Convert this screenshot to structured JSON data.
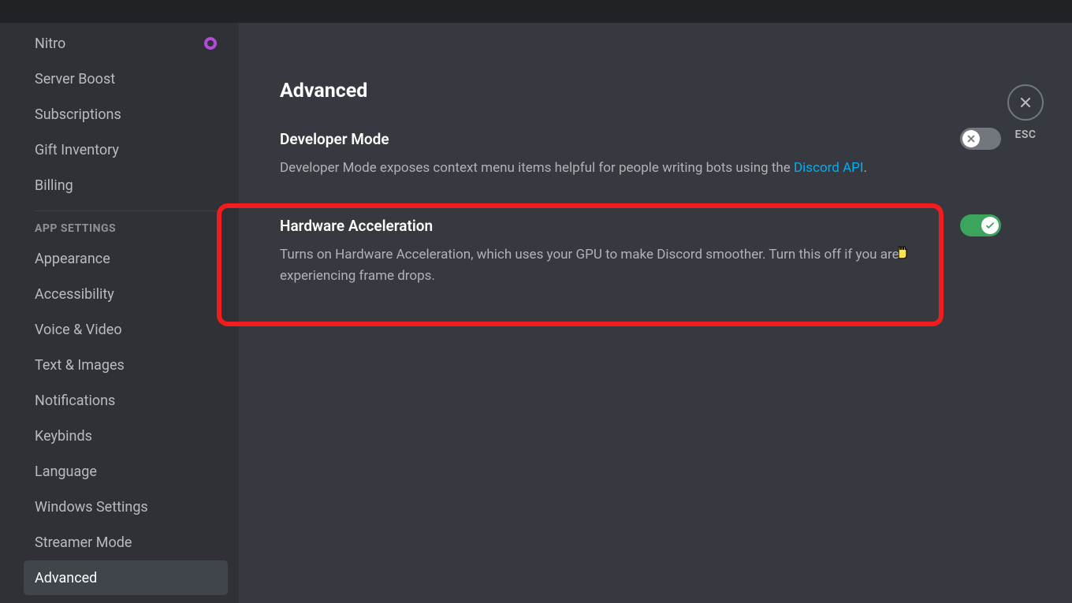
{
  "sidebar": {
    "billing_items": [
      {
        "label": "Nitro",
        "badge": true
      },
      {
        "label": "Server Boost"
      },
      {
        "label": "Subscriptions"
      },
      {
        "label": "Gift Inventory"
      },
      {
        "label": "Billing"
      }
    ],
    "section_header": "APP SETTINGS",
    "app_items": [
      {
        "label": "Appearance"
      },
      {
        "label": "Accessibility"
      },
      {
        "label": "Voice & Video"
      },
      {
        "label": "Text & Images"
      },
      {
        "label": "Notifications"
      },
      {
        "label": "Keybinds"
      },
      {
        "label": "Language"
      },
      {
        "label": "Windows Settings"
      },
      {
        "label": "Streamer Mode"
      },
      {
        "label": "Advanced",
        "selected": true
      }
    ]
  },
  "page": {
    "title": "Advanced",
    "close_label": "ESC"
  },
  "settings": {
    "dev_mode": {
      "title": "Developer Mode",
      "desc_pre": "Developer Mode exposes context menu items helpful for people writing bots using the ",
      "link_text": "Discord API",
      "desc_post": ".",
      "enabled": false
    },
    "hw_accel": {
      "title": "Hardware Acceleration",
      "desc": "Turns on Hardware Acceleration, which uses your GPU to make Discord smoother. Turn this off if you are experiencing frame drops.",
      "enabled": true
    }
  },
  "annotation": {
    "highlight_color": "#f11c1c"
  }
}
